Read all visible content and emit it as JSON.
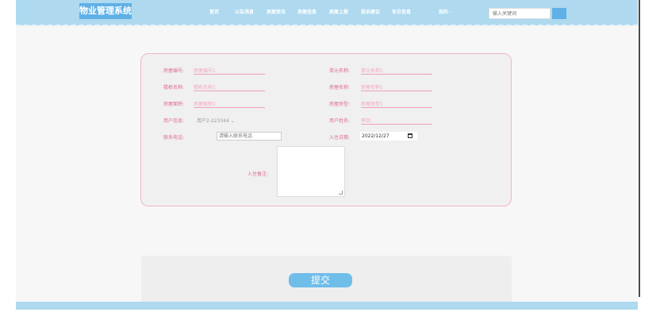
{
  "nav": {
    "brand": "物业管理系统",
    "items": [
      "首页",
      "公告消息",
      "房屋资讯",
      "房屋信息",
      "房屋上报",
      "投诉建议",
      "车位信息",
      "我的 ·"
    ],
    "search_placeholder": "输入关键词"
  },
  "form": {
    "house_no_label": "房屋编号:",
    "house_no_value": "房屋编号1",
    "unit_name_label": "单元名称:",
    "unit_name_value": "单元名称1",
    "building_label": "楼栋名称:",
    "building_value": "楼栋名称1",
    "house_name_label": "房屋名称:",
    "house_name_value": "房屋名称1",
    "area_label": "房屋面积:",
    "area_value": "房屋面积1",
    "house_type_label": "房屋房型:",
    "house_type_value": "房屋房型1",
    "user_info_label": "用户信息:",
    "user_info_value": "用户2-223344 ⌄",
    "user_name_label": "用户姓名:",
    "user_name_value": "李四",
    "phone_label": "联系电话:",
    "phone_placeholder": "请输入联系电话",
    "checkin_label": "入住日期:",
    "checkin_value": "2022/12/27",
    "note_label": "入住备注:"
  },
  "submit_label": "提交"
}
